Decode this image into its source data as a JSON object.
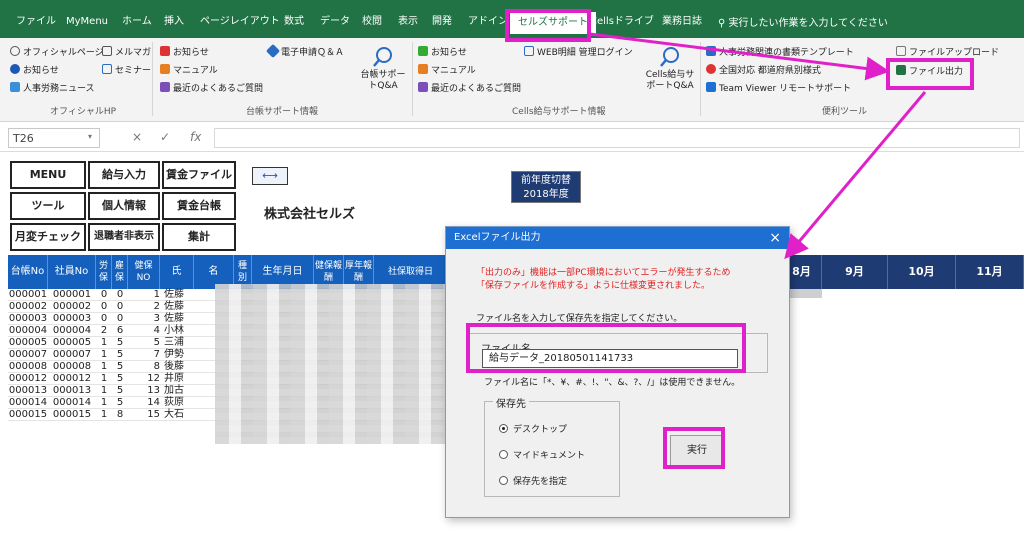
{
  "ribbon_tabs": [
    "ファイル",
    "MyMenu",
    "ホーム",
    "挿入",
    "ページレイアウト",
    "数式",
    "データ",
    "校閲",
    "表示",
    "開発",
    "アドイン",
    "セルズサポート",
    "Cellsドライブ",
    "業務日誌"
  ],
  "tell_me": "実行したい作業を入力してください",
  "ribbon": {
    "group1": {
      "items": [
        "オフィシャルページ",
        "メルマガ",
        "お知らせ",
        "セミナー",
        "人事労務ニュース"
      ],
      "label": "オフィシャルHP"
    },
    "group2": {
      "items": [
        "お知らせ",
        "電子申請Ｑ＆Ａ",
        "マニュアル",
        "最近のよくあるご質問"
      ],
      "big_button": "台帳サポートQ&A",
      "label": "台帳サポート情報"
    },
    "group3": {
      "items": [
        "お知らせ",
        "WEB明細 管理ログイン",
        "マニュアル",
        "最近のよくあるご質問"
      ],
      "big_button": "Cells給与サポートQ&A",
      "label": "Cells給与サポート情報"
    },
    "group4": {
      "items": [
        "人事労務関連の書類テンプレート",
        "全国対応 都道府県別様式",
        "Team Viewer リモートサポート",
        "ファイルアップロード",
        "ファイル出力"
      ],
      "label": "便利ツール"
    }
  },
  "formula_bar": {
    "name_box": "T26",
    "fx": "fx"
  },
  "sheet": {
    "buttons": [
      "MENU",
      "給与入力",
      "賃金ファイル",
      "ツール",
      "個人情報",
      "賃金台帳",
      "月変チェック",
      "退職者非表示",
      "集計"
    ],
    "company": "株式会社セルズ",
    "year_toggle_line1": "前年度切替",
    "year_toggle_line2": "2018年度",
    "columns": [
      "台帳No",
      "社員No",
      "労保",
      "雇保",
      "健保NO",
      "氏",
      "名",
      "種別",
      "生年月日",
      "健保報酬",
      "厚年報酬",
      "社保取得日"
    ],
    "months": [
      "8月",
      "9月",
      "10月",
      "11月"
    ],
    "rows": [
      [
        "000001",
        "000001",
        "0",
        "0",
        "1",
        "佐藤"
      ],
      [
        "000002",
        "000002",
        "0",
        "0",
        "2",
        "佐藤"
      ],
      [
        "000003",
        "000003",
        "0",
        "0",
        "3",
        "佐藤"
      ],
      [
        "000004",
        "000004",
        "2",
        "6",
        "4",
        "小林"
      ],
      [
        "000005",
        "000005",
        "1",
        "5",
        "5",
        "三浦"
      ],
      [
        "000007",
        "000007",
        "1",
        "5",
        "7",
        "伊勢"
      ],
      [
        "000008",
        "000008",
        "1",
        "5",
        "8",
        "後藤"
      ],
      [
        "000012",
        "000012",
        "1",
        "5",
        "12",
        "井原"
      ],
      [
        "000013",
        "000013",
        "1",
        "5",
        "13",
        "加古"
      ],
      [
        "000014",
        "000014",
        "1",
        "5",
        "14",
        "荻原"
      ],
      [
        "000015",
        "000015",
        "1",
        "8",
        "15",
        "大石"
      ]
    ]
  },
  "dialog": {
    "title": "Excelファイル出力",
    "close": "×",
    "warning_line1": "「出力のみ」機能は一部PC環境においてエラーが発生するため",
    "warning_line2": "「保存ファイルを作成する」ように仕様変更されました。",
    "instruction": "ファイル名を入力して保存先を指定してください。",
    "filename_label": "ファイル名",
    "filename_value": "給与データ_20180501141733",
    "filename_note": "ファイル名に「*、¥、#、!、\"、&、?、/」は使用できません。",
    "save_to_label": "保存先",
    "options": [
      "デスクトップ",
      "マイドキュメント",
      "保存先を指定"
    ],
    "selected_option": "デスクトップ",
    "run_button": "実行"
  },
  "colors": {
    "ribbon_green": "#217346",
    "header_blue": "#1560bd",
    "month_navy": "#1f3b73",
    "highlight_magenta": "#e020c8",
    "dialog_title_blue": "#1e6fd2",
    "warning_red": "#e02020"
  }
}
